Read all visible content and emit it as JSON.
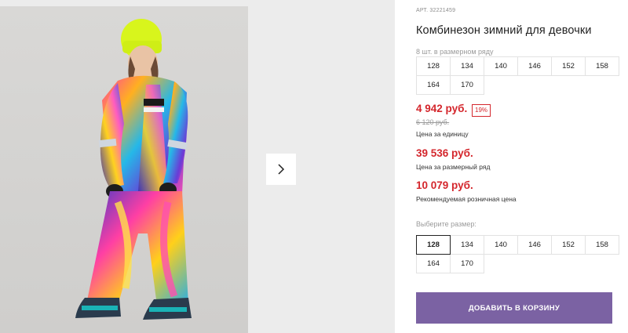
{
  "product": {
    "sku": "АРТ. 32221459",
    "title": "Комбинезон зимний для девочки",
    "pack_note": "8 шт. в размерном ряду",
    "pack_sizes": [
      "128",
      "134",
      "140",
      "146",
      "152",
      "158",
      "164",
      "170"
    ],
    "price": "4 942 руб.",
    "discount": "19%",
    "old_price": "6 120 руб.",
    "price_caption": "Цена за единицу",
    "pack_price": "39 536 руб.",
    "pack_price_caption": "Цена за размерный ряд",
    "rrp_price": "10 079 руб.",
    "rrp_caption": "Рекомендуемая розничная цена",
    "choose_size_label": "Выберите размер:",
    "sizes": [
      "128",
      "134",
      "140",
      "146",
      "152",
      "158",
      "164",
      "170"
    ],
    "selected_size": "128",
    "add_to_cart_label": "ДОБАВИТЬ В КОРЗИНУ"
  },
  "gallery": {
    "next_icon": "chevron-right-icon"
  },
  "colors": {
    "price": "#d4262c",
    "button": "#7b62a3",
    "gallery_bg": "#ececec"
  }
}
